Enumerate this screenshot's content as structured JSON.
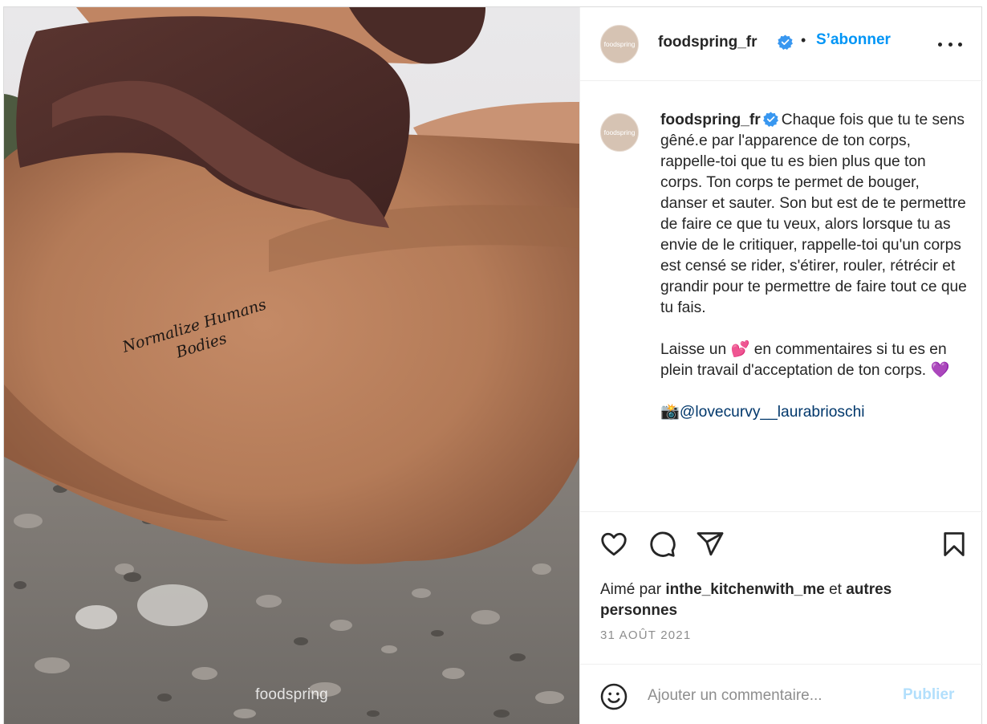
{
  "photo": {
    "tattoo_line1": "Normalize Humans",
    "tattoo_line2": "Bodies",
    "watermark": "foodspring"
  },
  "account": {
    "avatar_text": "foodspring",
    "username": "foodspring_fr",
    "verified_icon": "verified-badge-icon",
    "separator": "•",
    "follow_label": "S’abonner",
    "more_icon": "more-options-icon"
  },
  "caption": {
    "username": "foodspring_fr",
    "paragraph1": "Chaque fois que tu te sens gêné.e par l'apparence de ton corps, rappelle-toi que tu es bien plus que ton corps. Ton corps te permet de bouger, danser et sauter. Son but est de te permettre de faire ce que tu veux, alors lorsque tu as envie de le critiquer, rappelle-toi qu'un corps est censé se rider, s'étirer, rouler, rétrécir et grandir pour te permettre de faire tout ce que tu fais.",
    "paragraph2": "Laisse un 💕 en commentaires si tu es en plein travail d'acceptation de ton corps. 💜",
    "credit_emoji": "📸",
    "credit_mention": "@lovecurvy__laurabrioschi"
  },
  "actions": {
    "like_icon": "heart-icon",
    "comment_icon": "comment-bubble-icon",
    "share_icon": "paper-plane-icon",
    "save_icon": "bookmark-icon"
  },
  "likes": {
    "prefix": "Aimé par ",
    "liker": "inthe_kitchenwith_me",
    "connector": " et ",
    "others": "autres personnes"
  },
  "date": "31 AOÛT 2021",
  "comment": {
    "emoji_icon": "smiley-icon",
    "placeholder": "Ajouter un commentaire...",
    "publish_label": "Publier"
  },
  "colors": {
    "accent_blue": "#0095f6",
    "publish_disabled": "#b2dffc",
    "verified_blue": "#3897f0",
    "mention_dark_blue": "#00376b",
    "meta_gray": "#8e8e8e"
  }
}
